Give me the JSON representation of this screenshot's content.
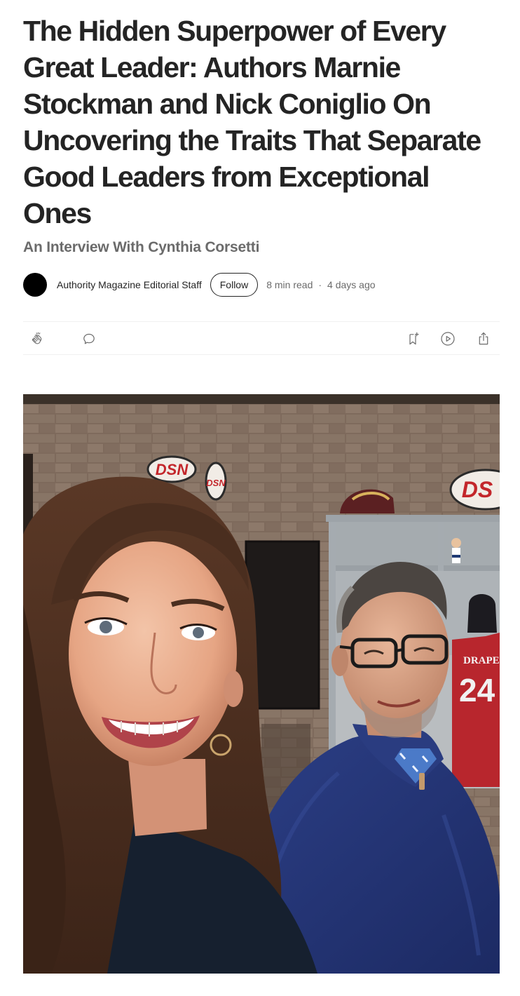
{
  "article": {
    "title": "The Hidden Superpower of Every Great Leader: Authors Marnie Stockman and Nick Coniglio On Uncovering the Traits That Separate Good Leaders from Exceptional Ones",
    "subtitle": "An Interview With Cynthia Corsetti"
  },
  "byline": {
    "author": "Authority Magazine Editorial Staff",
    "follow_label": "Follow",
    "read_time": "8 min read",
    "separator": "·",
    "published": "4 days ago"
  },
  "actions": {
    "left": [
      "clap-icon",
      "comment-icon"
    ],
    "right": [
      "bookmark-add-icon",
      "play-icon",
      "share-icon"
    ]
  },
  "hero_image": {
    "signs": {
      "sign_1": "DSN",
      "sign_2": "DSN",
      "sign_3": "DS"
    },
    "jersey": {
      "name": "DRAPE",
      "number": "24"
    }
  },
  "colors": {
    "text": "#242424",
    "muted": "#6b6b6b",
    "divider": "#f0f0f0",
    "avatar": "#000000"
  }
}
